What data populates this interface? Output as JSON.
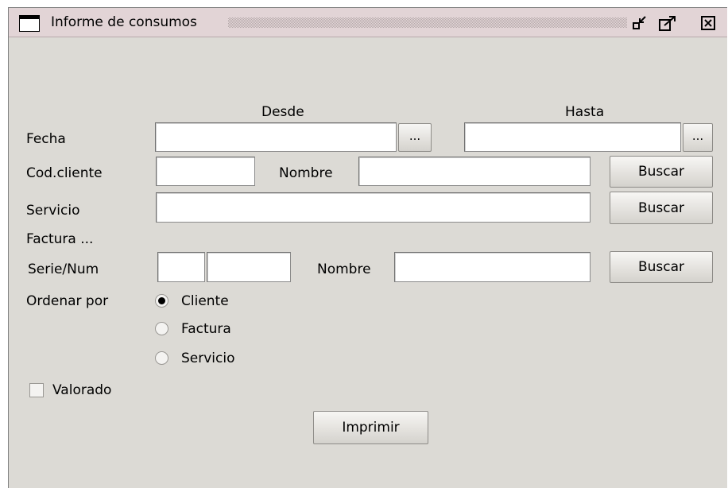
{
  "window": {
    "title": "Informe de consumos",
    "icons": {
      "app": "window-icon",
      "minimize": "minimize-icon",
      "maximize": "maximize-icon",
      "close": "close-icon"
    }
  },
  "form": {
    "column_from": "Desde",
    "column_to": "Hasta",
    "date_label": "Fecha",
    "date_from_value": "",
    "date_to_value": "",
    "date_picker_label": "...",
    "client_code_label": "Cod.cliente",
    "client_code_value": "",
    "client_name_label": "Nombre",
    "client_name_value": "",
    "client_search_label": "Buscar",
    "service_label": "Servicio",
    "service_value": "",
    "service_search_label": "Buscar",
    "invoice_section_label": "Factura ...",
    "series_num_label": "Serie/Num",
    "series_value": "",
    "number_value": "",
    "invoice_name_label": "Nombre",
    "invoice_name_value": "",
    "invoice_search_label": "Buscar",
    "order_by_label": "Ordenar por",
    "order_options": [
      "Cliente",
      "Factura",
      "Servicio"
    ],
    "order_selected": "Cliente",
    "valued_label": "Valorado",
    "valued_checked": false,
    "print_label": "Imprimir"
  }
}
